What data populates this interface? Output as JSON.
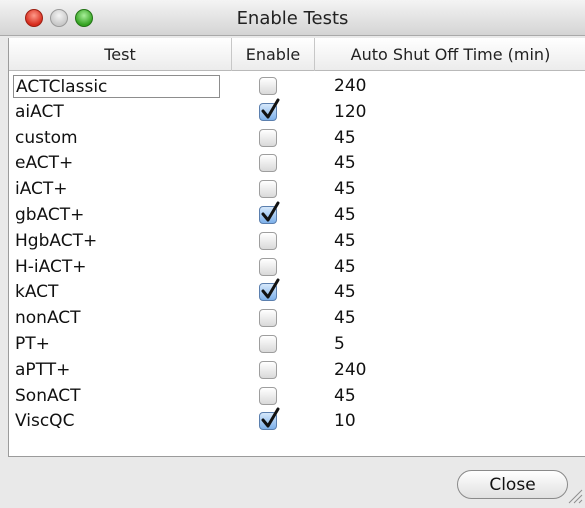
{
  "window": {
    "title": "Enable Tests"
  },
  "table": {
    "headers": {
      "test": "Test",
      "enable": "Enable",
      "time": "Auto Shut Off Time (min)"
    },
    "rows": [
      {
        "name": "ACTClassic",
        "enabled": false,
        "time": "240",
        "editing": true
      },
      {
        "name": "aiACT",
        "enabled": true,
        "time": "120"
      },
      {
        "name": "custom",
        "enabled": false,
        "time": "45"
      },
      {
        "name": "eACT+",
        "enabled": false,
        "time": "45"
      },
      {
        "name": "iACT+",
        "enabled": false,
        "time": "45"
      },
      {
        "name": "gbACT+",
        "enabled": true,
        "time": "45"
      },
      {
        "name": "HgbACT+",
        "enabled": false,
        "time": "45"
      },
      {
        "name": "H-iACT+",
        "enabled": false,
        "time": "45"
      },
      {
        "name": "kACT",
        "enabled": true,
        "time": "45"
      },
      {
        "name": "nonACT",
        "enabled": false,
        "time": "45"
      },
      {
        "name": "PT+",
        "enabled": false,
        "time": "5"
      },
      {
        "name": "aPTT+",
        "enabled": false,
        "time": "240"
      },
      {
        "name": "SonACT",
        "enabled": false,
        "time": "45"
      },
      {
        "name": "ViscQC",
        "enabled": true,
        "time": "10"
      }
    ]
  },
  "footer": {
    "close_label": "Close"
  }
}
